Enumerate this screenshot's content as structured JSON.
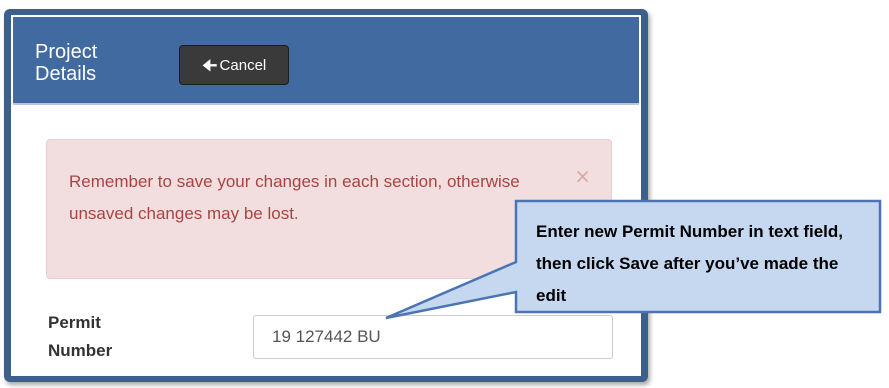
{
  "panel": {
    "title": "Project Details",
    "cancel_label": "Cancel"
  },
  "alert": {
    "message": "Remember to save your changes in each section, otherwise unsaved changes may be lost.",
    "close_symbol": "×"
  },
  "permit": {
    "label": "Permit Number",
    "value": "19 127442 BU"
  },
  "callout": {
    "text": "Enter new Permit Number in text field, then click Save after you’ve made the edit"
  },
  "colors": {
    "frame": "#3d5f8b",
    "header": "#416aa0",
    "alert_bg": "#f2dede",
    "alert_text": "#a94442",
    "callout_bg": "#c6d8f0",
    "callout_border": "#4a74b4"
  }
}
